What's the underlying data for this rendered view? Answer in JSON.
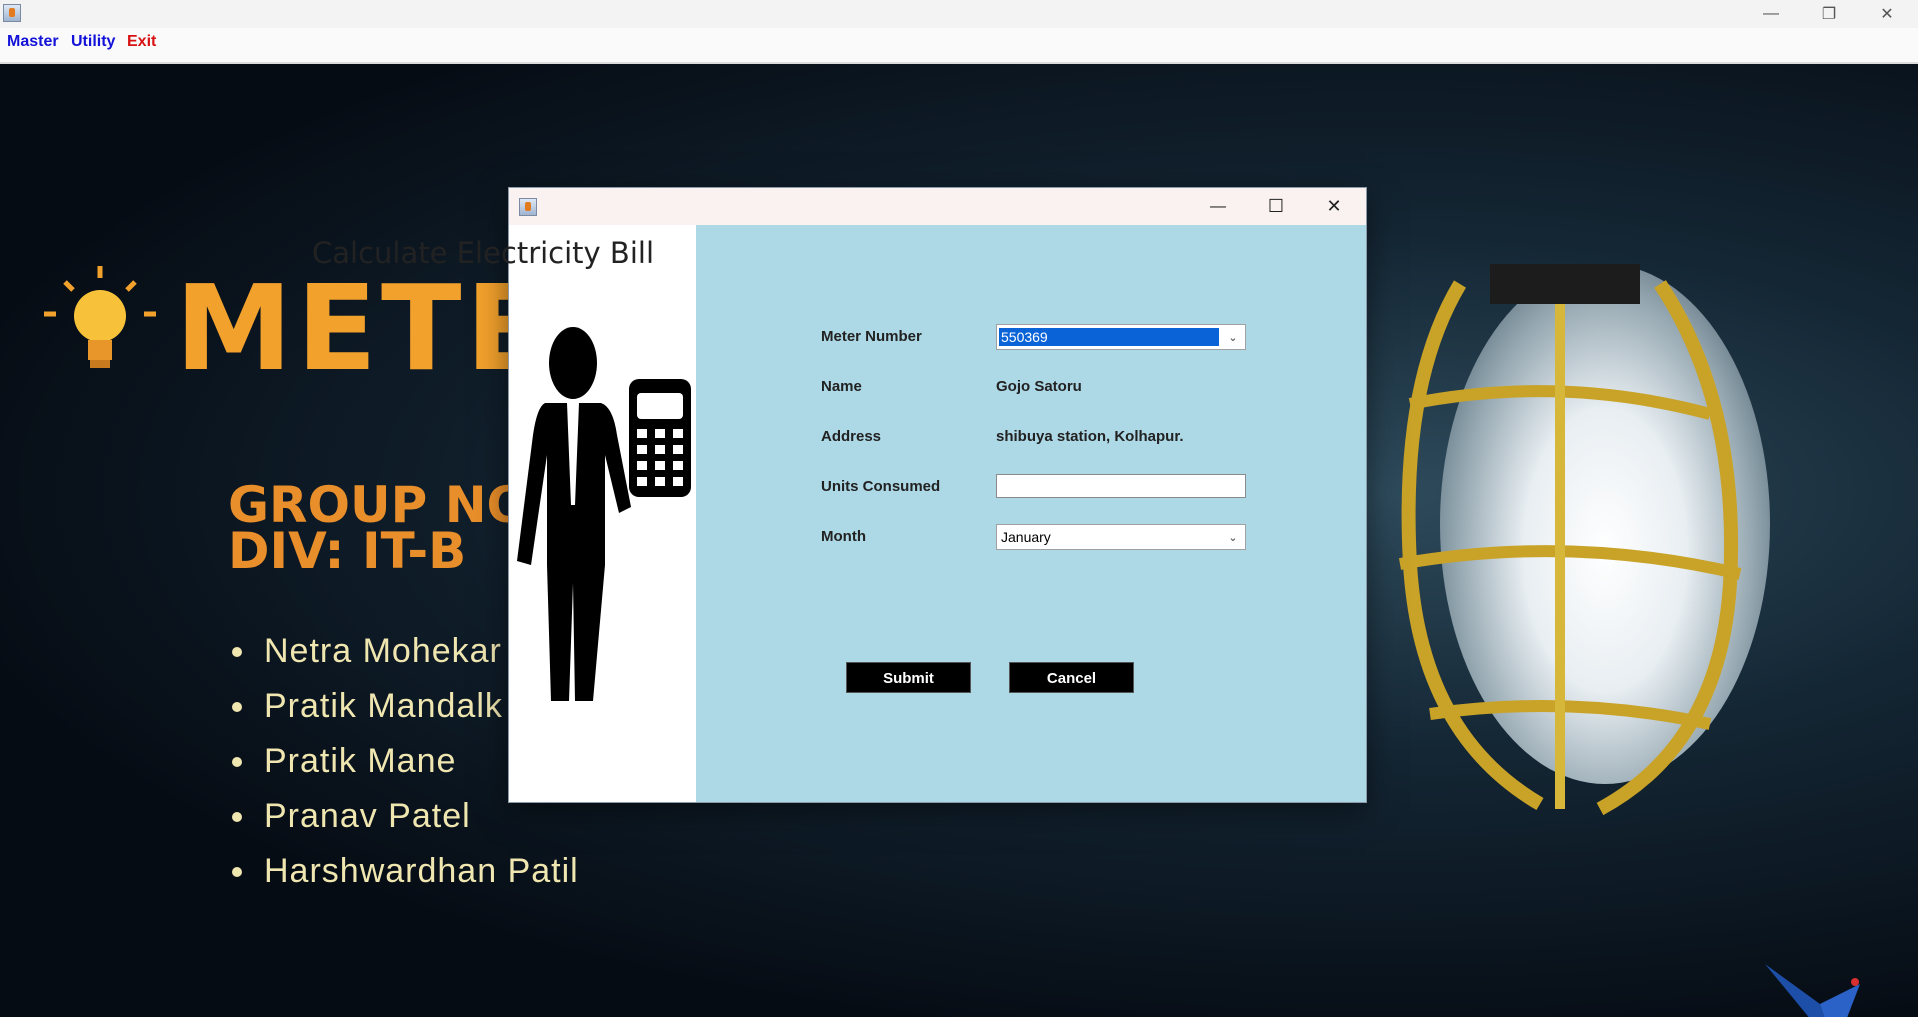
{
  "window": {
    "minimize": "—",
    "restore": "❐",
    "close": "✕"
  },
  "menu": [
    {
      "label": "Master",
      "color": "#1212d8"
    },
    {
      "label": "Utility",
      "color": "#1212d8"
    },
    {
      "label": "Exit",
      "color": "#d81212"
    }
  ],
  "background": {
    "title": "METE",
    "group": "GROUP NO:",
    "division": "DIV: IT-B",
    "members": [
      "Netra Mohekar",
      "Pratik Mandalk",
      "Pratik Mane",
      "Pranav Patel",
      "Harshwardhan Patil"
    ]
  },
  "dialog": {
    "heading": "Calculate Electricity Bill",
    "controls": {
      "minimize": "—",
      "maximize": "☐",
      "close": "✕"
    },
    "fields": {
      "meter_number": {
        "label": "Meter Number",
        "value": "550369"
      },
      "name": {
        "label": "Name",
        "value": "Gojo Satoru"
      },
      "address": {
        "label": "Address",
        "value": "shibuya station, Kolhapur."
      },
      "units_consumed": {
        "label": "Units Consumed",
        "value": ""
      },
      "month": {
        "label": "Month",
        "value": "January"
      }
    },
    "buttons": {
      "submit": "Submit",
      "cancel": "Cancel"
    }
  },
  "colors": {
    "dialog_bg": "#add8e6",
    "accent_orange": "#f2a12c",
    "selection": "#0a64d8"
  }
}
